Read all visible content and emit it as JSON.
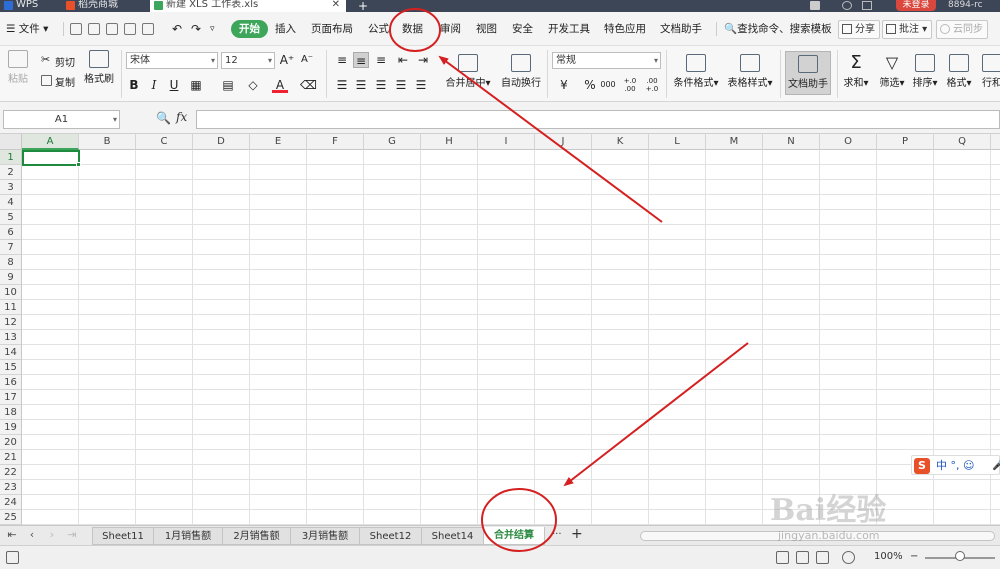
{
  "titlebar": {
    "tabs": [
      {
        "label": "WPS"
      },
      {
        "label": "稻壳商城"
      },
      {
        "label": "新建 XLS 工作表.xls"
      }
    ],
    "login": "未登录",
    "user": "8894-rc"
  },
  "menubar": {
    "file": "文件",
    "items": [
      "开始",
      "插入",
      "页面布局",
      "公式",
      "数据",
      "审阅",
      "视图",
      "安全",
      "开发工具",
      "特色应用",
      "文档助手"
    ],
    "search": "查找命令、搜索模板",
    "share": "分享",
    "comment": "批注",
    "sync": "云同步"
  },
  "ribbon": {
    "paste": "粘贴",
    "cut": "剪切",
    "copy": "复制",
    "format_painter": "格式刷",
    "font_name": "宋体",
    "font_size": "12",
    "merge": "合并居中",
    "wrap": "自动换行",
    "number_format": "常规",
    "percent": "%",
    "thousands": "000",
    "dec_inc": "+.0\n.00",
    "dec_dec": ".00\n+.0",
    "cond_format": "条件格式",
    "table_style": "表格样式",
    "doc_helper": "文档助手",
    "sum": "求和",
    "filter": "筛选",
    "sort": "排序",
    "format": "格式",
    "rowcol": "行和"
  },
  "formula": {
    "name_box": "A1",
    "fx": "fx"
  },
  "grid": {
    "columns": [
      "A",
      "B",
      "C",
      "D",
      "E",
      "F",
      "G",
      "H",
      "I",
      "J",
      "K",
      "L",
      "M",
      "N",
      "O",
      "P",
      "Q"
    ],
    "rows": [
      "1",
      "2",
      "3",
      "4",
      "5",
      "6",
      "7",
      "8",
      "9",
      "10",
      "11",
      "12",
      "13",
      "14",
      "15",
      "16",
      "17",
      "18",
      "19",
      "20",
      "21",
      "22",
      "23",
      "24",
      "25"
    ]
  },
  "sheets": {
    "tabs": [
      "Sheet11",
      "1月销售额",
      "2月销售额",
      "3月销售额",
      "Sheet12",
      "Sheet14",
      "合并结算"
    ],
    "active_index": 6,
    "more": "···",
    "add": "+"
  },
  "status": {
    "zoom": "100%",
    "zoom_minus": "−"
  },
  "ime": {
    "logo": "S",
    "text": "中 °, ☺"
  },
  "watermark": {
    "text": "Bai经验",
    "url": "jingyan.baidu.com"
  },
  "colors": {
    "accent_green": "#3ea65a",
    "annotation_red": "#d42020",
    "titlebar": "#3d4656",
    "login_red": "#d9473d"
  }
}
